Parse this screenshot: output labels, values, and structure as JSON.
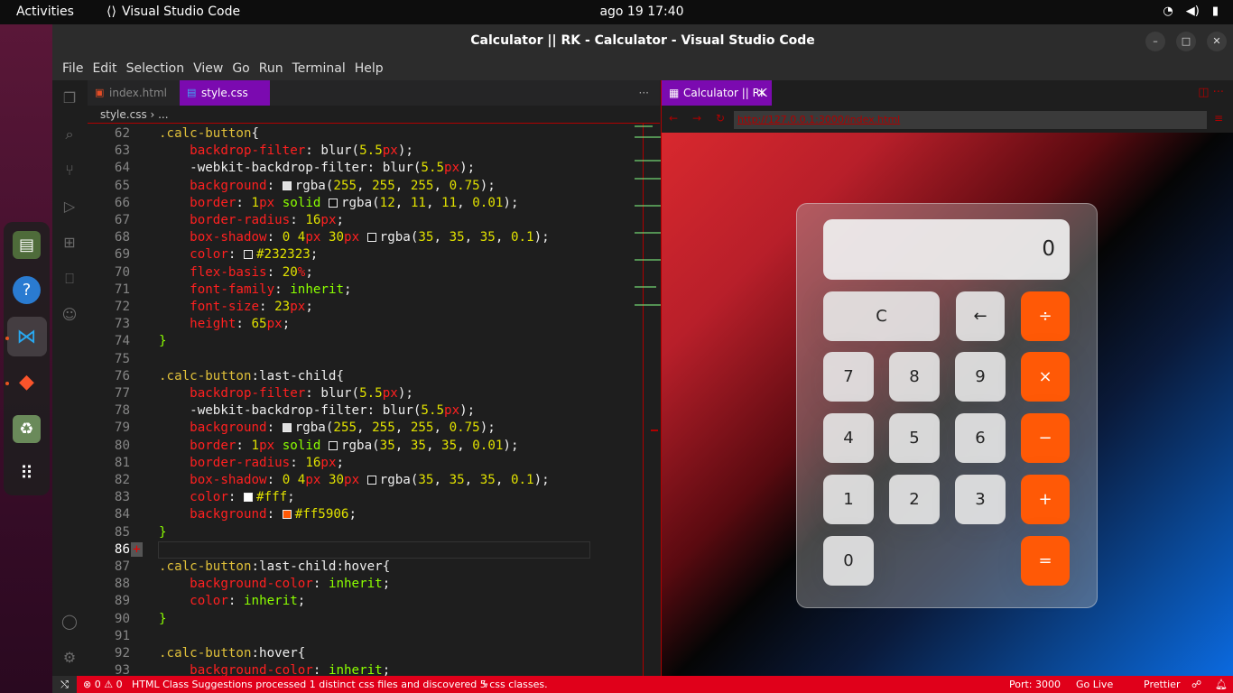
{
  "topbar": {
    "activities": "Activities",
    "app": "Visual Studio Code",
    "clock": "ago 19  17:40"
  },
  "window": {
    "title": "Calculator || RK - Calculator - Visual Studio Code"
  },
  "menu": [
    "File",
    "Edit",
    "Selection",
    "View",
    "Go",
    "Run",
    "Terminal",
    "Help"
  ],
  "tabs": {
    "t1": "index.html",
    "t2": "style.css",
    "more": "···"
  },
  "breadcrumb": "style.css › ...",
  "code": [
    {
      "n": "62",
      "h": "<span class='sel'>.calc-button</span><span class='wht'>{</span>"
    },
    {
      "n": "63",
      "h": "    <span class='prop'>backdrop-filter</span><span class='wht'>: </span><span class='wht'>blur(</span><span class='num'>5.5</span><span class='unit'>px</span><span class='wht'>);</span>"
    },
    {
      "n": "64",
      "h": "    <span class='wht'>-webkit-backdrop-filter: blur(</span><span class='num'>5.5</span><span class='unit'>px</span><span class='wht'>);</span>"
    },
    {
      "n": "65",
      "h": "    <span class='prop'>background</span><span class='wht'>: </span><span class='sw' style='background:#e0e0e0'></span><span class='wht'>rgba(</span><span class='num'>255</span><span class='wht'>, </span><span class='num'>255</span><span class='wht'>, </span><span class='num'>255</span><span class='wht'>, </span><span class='num'>0.75</span><span class='wht'>);</span>"
    },
    {
      "n": "66",
      "h": "    <span class='prop'>border</span><span class='wht'>: </span><span class='num'>1</span><span class='unit'>px</span><span class='val'> solid </span><span class='sw' style='background:#111'></span><span class='wht'>rgba(</span><span class='num'>12</span><span class='wht'>, </span><span class='num'>11</span><span class='wht'>, </span><span class='num'>11</span><span class='wht'>, </span><span class='num'>0.01</span><span class='wht'>);</span>"
    },
    {
      "n": "67",
      "h": "    <span class='prop'>border-radius</span><span class='wht'>: </span><span class='num'>16</span><span class='unit'>px</span><span class='wht'>;</span>"
    },
    {
      "n": "68",
      "h": "    <span class='prop'>box-shadow</span><span class='wht'>: </span><span class='num'>0 4</span><span class='unit'>px</span><span class='num'> 30</span><span class='unit'>px</span><span class='wht'> </span><span class='sw' style='background:#111'></span><span class='wht'>rgba(</span><span class='num'>35</span><span class='wht'>, </span><span class='num'>35</span><span class='wht'>, </span><span class='num'>35</span><span class='wht'>, </span><span class='num'>0.1</span><span class='wht'>);</span>"
    },
    {
      "n": "69",
      "h": "    <span class='prop'>color</span><span class='wht'>: </span><span class='sw' style='background:#232323'></span><span class='num'>#232323</span><span class='wht'>;</span>"
    },
    {
      "n": "70",
      "h": "    <span class='prop'>flex-basis</span><span class='wht'>: </span><span class='num'>20</span><span class='unit'>%</span><span class='wht'>;</span>"
    },
    {
      "n": "71",
      "h": "    <span class='prop'>font-family</span><span class='wht'>: </span><span class='val'>inherit</span><span class='wht'>;</span>"
    },
    {
      "n": "72",
      "h": "    <span class='prop'>font-size</span><span class='wht'>: </span><span class='num'>23</span><span class='unit'>px</span><span class='wht'>;</span>"
    },
    {
      "n": "73",
      "h": "    <span class='prop'>height</span><span class='wht'>: </span><span class='num'>65</span><span class='unit'>px</span><span class='wht'>;</span>"
    },
    {
      "n": "74",
      "h": "<span class='val'>}</span>"
    },
    {
      "n": "75",
      "h": ""
    },
    {
      "n": "76",
      "h": "<span class='sel'>.calc-button</span><span class='wht'>:last-child{</span>"
    },
    {
      "n": "77",
      "h": "    <span class='prop'>backdrop-filter</span><span class='wht'>: blur(</span><span class='num'>5.5</span><span class='unit'>px</span><span class='wht'>);</span>"
    },
    {
      "n": "78",
      "h": "    <span class='wht'>-webkit-backdrop-filter: blur(</span><span class='num'>5.5</span><span class='unit'>px</span><span class='wht'>);</span>"
    },
    {
      "n": "79",
      "h": "    <span class='prop'>background</span><span class='wht'>: </span><span class='sw' style='background:#e0e0e0'></span><span class='wht'>rgba(</span><span class='num'>255</span><span class='wht'>, </span><span class='num'>255</span><span class='wht'>, </span><span class='num'>255</span><span class='wht'>, </span><span class='num'>0.75</span><span class='wht'>);</span>"
    },
    {
      "n": "80",
      "h": "    <span class='prop'>border</span><span class='wht'>: </span><span class='num'>1</span><span class='unit'>px</span><span class='val'> solid </span><span class='sw' style='background:#111'></span><span class='wht'>rgba(</span><span class='num'>35</span><span class='wht'>, </span><span class='num'>35</span><span class='wht'>, </span><span class='num'>35</span><span class='wht'>, </span><span class='num'>0.01</span><span class='wht'>);</span>"
    },
    {
      "n": "81",
      "h": "    <span class='prop'>border-radius</span><span class='wht'>: </span><span class='num'>16</span><span class='unit'>px</span><span class='wht'>;</span>"
    },
    {
      "n": "82",
      "h": "    <span class='prop'>box-shadow</span><span class='wht'>: </span><span class='num'>0 4</span><span class='unit'>px</span><span class='num'> 30</span><span class='unit'>px</span><span class='wht'> </span><span class='sw' style='background:#111'></span><span class='wht'>rgba(</span><span class='num'>35</span><span class='wht'>, </span><span class='num'>35</span><span class='wht'>, </span><span class='num'>35</span><span class='wht'>, </span><span class='num'>0.1</span><span class='wht'>);</span>"
    },
    {
      "n": "83",
      "h": "    <span class='prop'>color</span><span class='wht'>: </span><span class='sw' style='background:#fff'></span><span class='num'>#fff</span><span class='wht'>;</span>"
    },
    {
      "n": "84",
      "h": "    <span class='prop'>background</span><span class='wht'>: </span><span class='sw' style='background:#ff5906'></span><span class='num'>#ff5906</span><span class='wht'>;</span>"
    },
    {
      "n": "85",
      "h": "<span class='val'>}</span>"
    },
    {
      "n": "86",
      "h": ""
    },
    {
      "n": "87",
      "h": "<span class='sel'>.calc-button</span><span class='wht'>:last-child:hover{</span>"
    },
    {
      "n": "88",
      "h": "    <span class='prop'>background-color</span><span class='wht'>: </span><span class='val'>inherit</span><span class='wht'>;</span>"
    },
    {
      "n": "89",
      "h": "    <span class='prop'>color</span><span class='wht'>: </span><span class='val'>inherit</span><span class='wht'>;</span>"
    },
    {
      "n": "90",
      "h": "<span class='val'>}</span>"
    },
    {
      "n": "91",
      "h": ""
    },
    {
      "n": "92",
      "h": "<span class='sel'>.calc-button</span><span class='wht'>:hover{</span>"
    },
    {
      "n": "93",
      "h": "    <span class='prop'>background-color</span><span class='wht'>: </span><span class='val'>inherit</span><span class='wht'>;</span>"
    }
  ],
  "preview": {
    "tab": "Calculator || RK",
    "url": "http://127.0.0.1:3000/index.html",
    "display": "0",
    "keys": {
      "clear": "C",
      "back": "←",
      "divide": "÷",
      "k7": "7",
      "k8": "8",
      "k9": "9",
      "multiply": "×",
      "k4": "4",
      "k5": "5",
      "k6": "6",
      "minus": "−",
      "k1": "1",
      "k2": "2",
      "k3": "3",
      "plus": "+",
      "k0": "0",
      "equals": "="
    }
  },
  "status": {
    "problems": "⊗ 0 ⚠ 0",
    "message": "HTML Class Suggestions processed 1 distinct css files and discovered 5 css classes.",
    "port": "Port: 3000",
    "golive": "Go Live",
    "prettier": "Prettier"
  }
}
